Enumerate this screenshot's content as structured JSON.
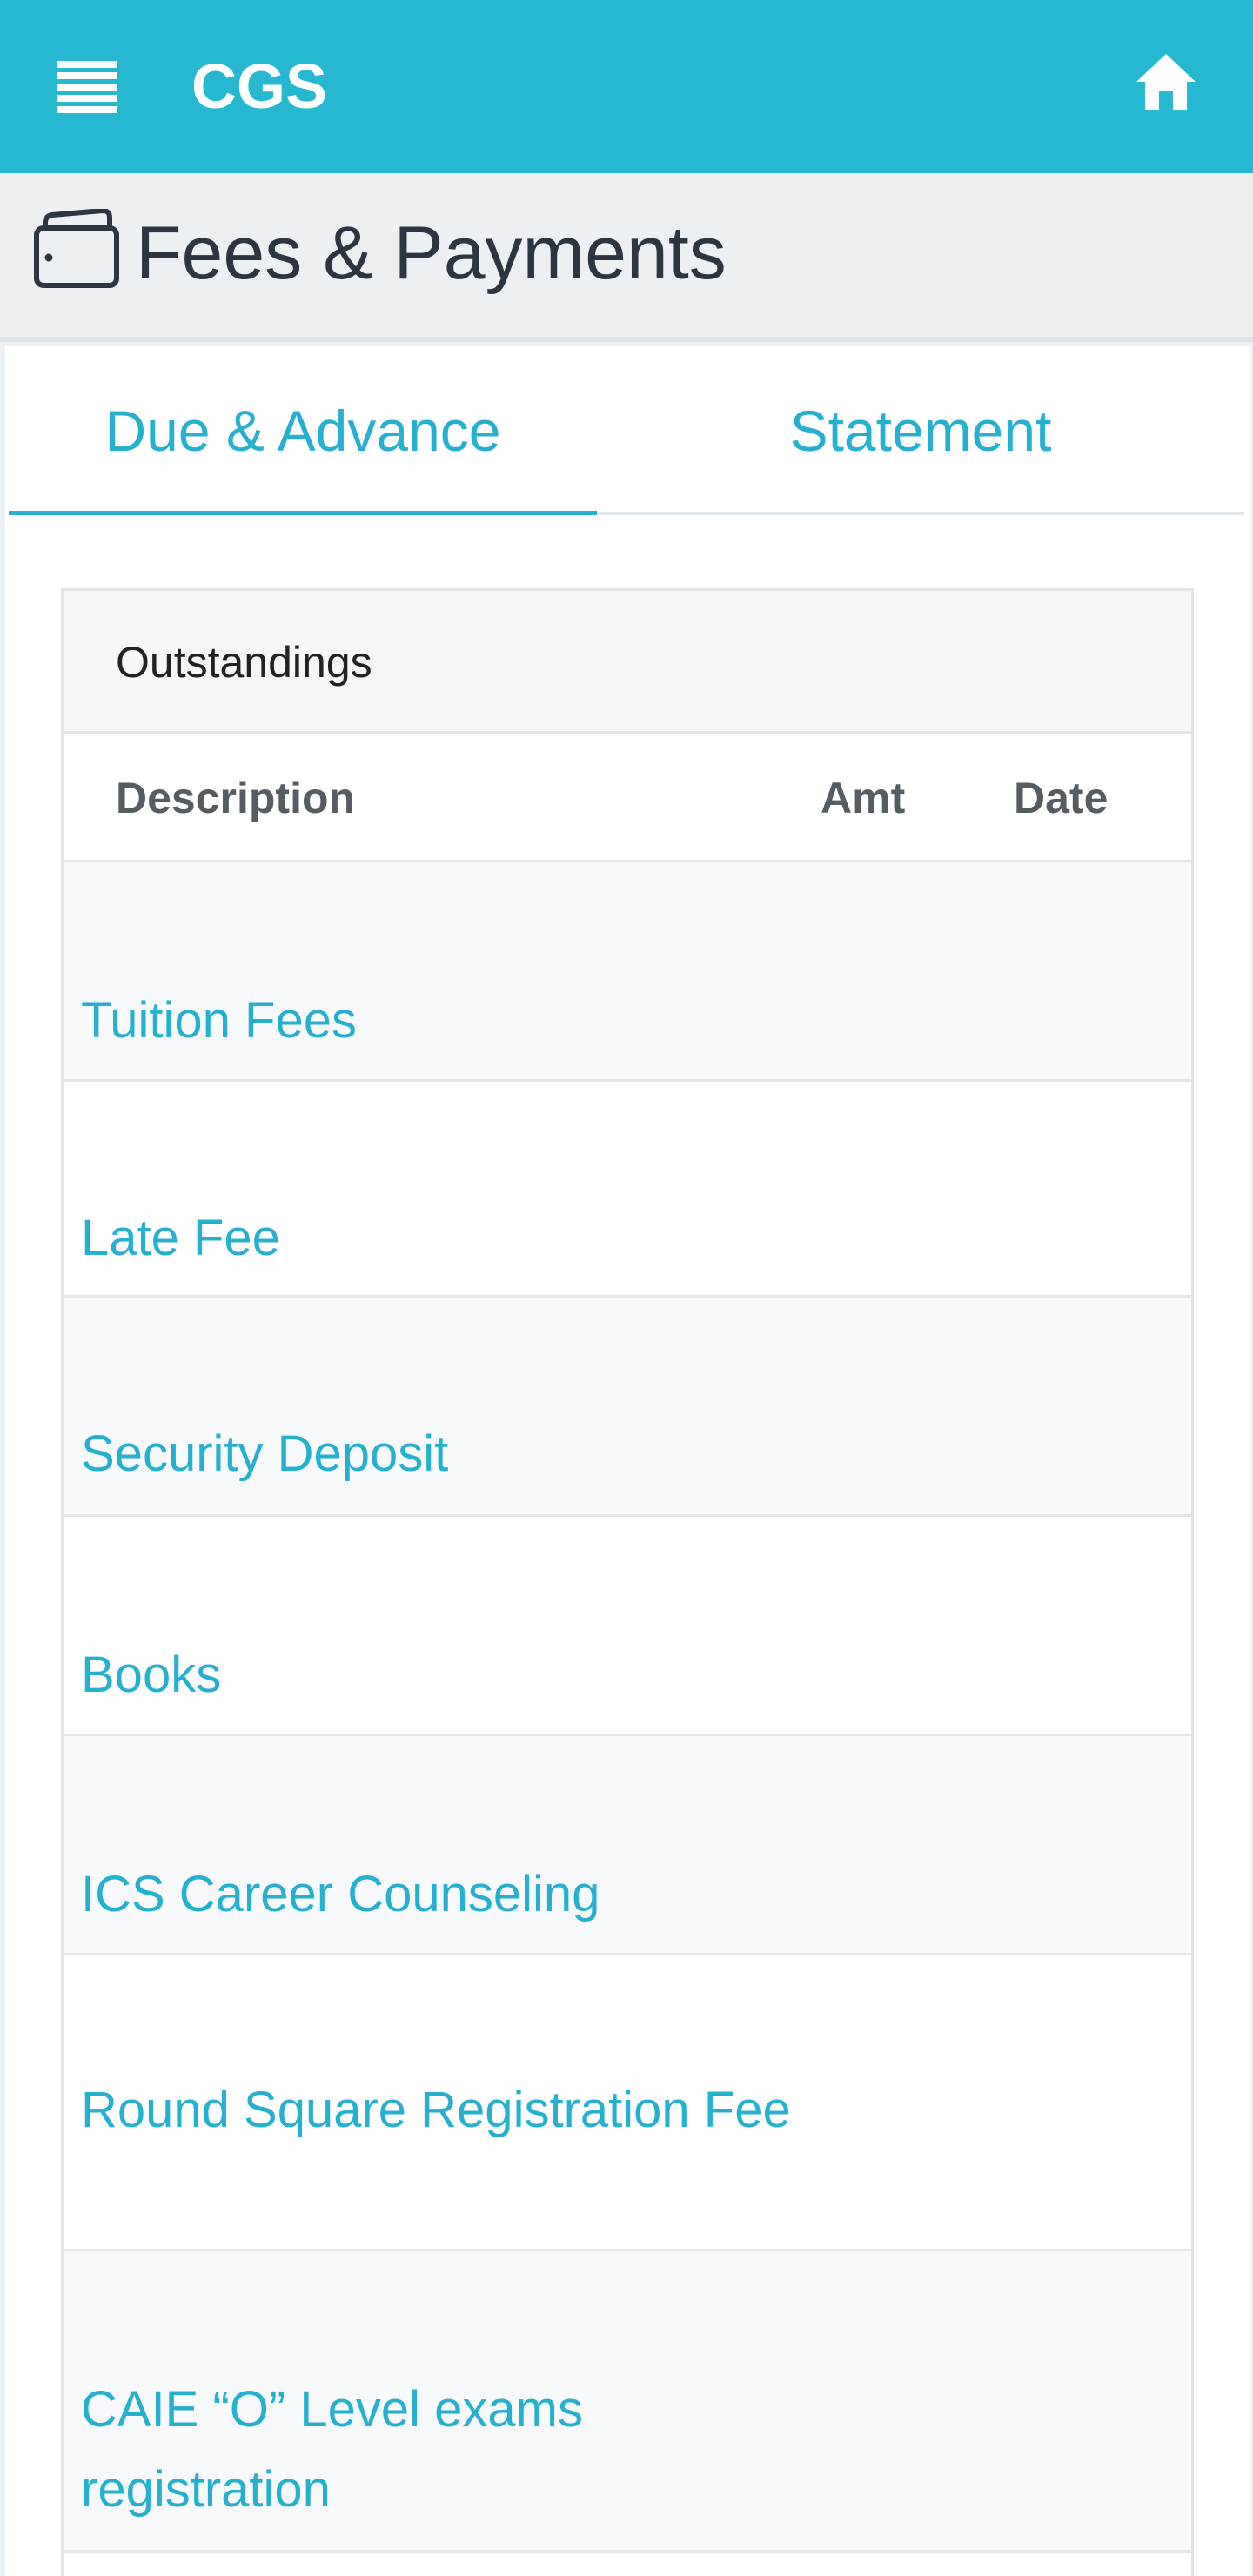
{
  "topbar": {
    "brand": "CGS",
    "menu_icon": "hamburger-menu-icon",
    "home_icon": "home-icon",
    "color": "#26b8d1"
  },
  "page": {
    "title": "Fees & Payments",
    "icon": "wallet-icon"
  },
  "tabs": [
    {
      "label": "Due & Advance",
      "active": true
    },
    {
      "label": "Statement",
      "active": false
    }
  ],
  "outstandings": {
    "heading": "Outstandings",
    "columns": [
      "Description",
      "Amt",
      "Date"
    ],
    "rows": [
      {
        "description": "Tuition Fees"
      },
      {
        "description": "Late Fee"
      },
      {
        "description": "Security Deposit"
      },
      {
        "description": "Books"
      },
      {
        "description": "ICS Career Counseling"
      },
      {
        "description": "Round Square Registration Fee"
      },
      {
        "description": "CAIE “O” Level exams registration"
      }
    ]
  }
}
